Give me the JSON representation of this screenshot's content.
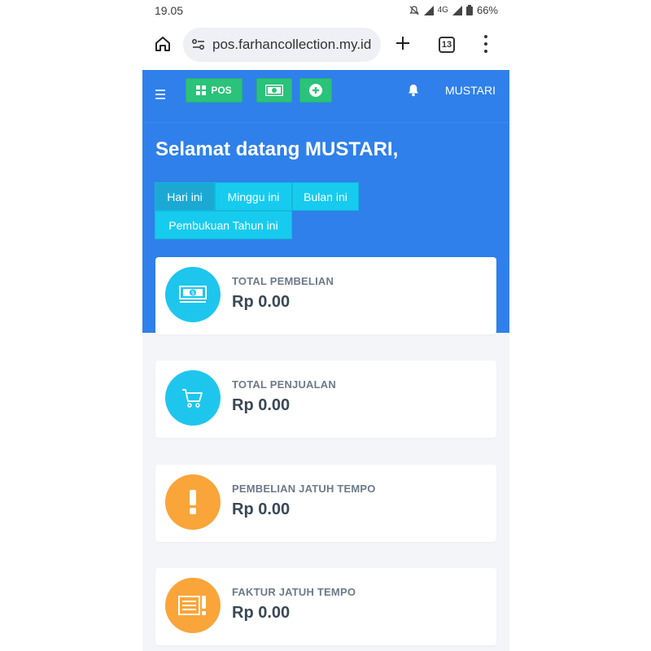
{
  "status_bar": {
    "time": "19.05",
    "network": "4G",
    "battery": "66%"
  },
  "browser": {
    "url": "pos.farhancollection.my.id",
    "tab_count": "13"
  },
  "app_bar": {
    "pos_label": "POS",
    "user_name": "MUSTARI"
  },
  "hero": {
    "welcome": "Selamat datang MUSTARI,",
    "filters": [
      {
        "label": "Hari ini",
        "active": true
      },
      {
        "label": "Minggu ini",
        "active": false
      },
      {
        "label": "Bulan ini",
        "active": false
      },
      {
        "label": "Pembukuan Tahun ini",
        "active": false
      }
    ]
  },
  "cards": [
    {
      "label": "TOTAL PEMBELIAN",
      "value": "Rp 0.00",
      "icon": "money-icon",
      "color": "#1ec6ee"
    },
    {
      "label": "TOTAL PENJUALAN",
      "value": "Rp 0.00",
      "icon": "cart-icon",
      "color": "#1ec6ee"
    },
    {
      "label": "PEMBELIAN JATUH TEMPO",
      "value": "Rp 0.00",
      "icon": "exclamation-icon",
      "color": "#f9a53a"
    },
    {
      "label": "FAKTUR JATUH TEMPO",
      "value": "Rp 0.00",
      "icon": "invoice-alert-icon",
      "color": "#f9a53a"
    }
  ],
  "colors": {
    "primary": "#2f80ea",
    "green": "#2bc27a",
    "cyan": "#17cbef",
    "orange": "#f9a53a"
  }
}
